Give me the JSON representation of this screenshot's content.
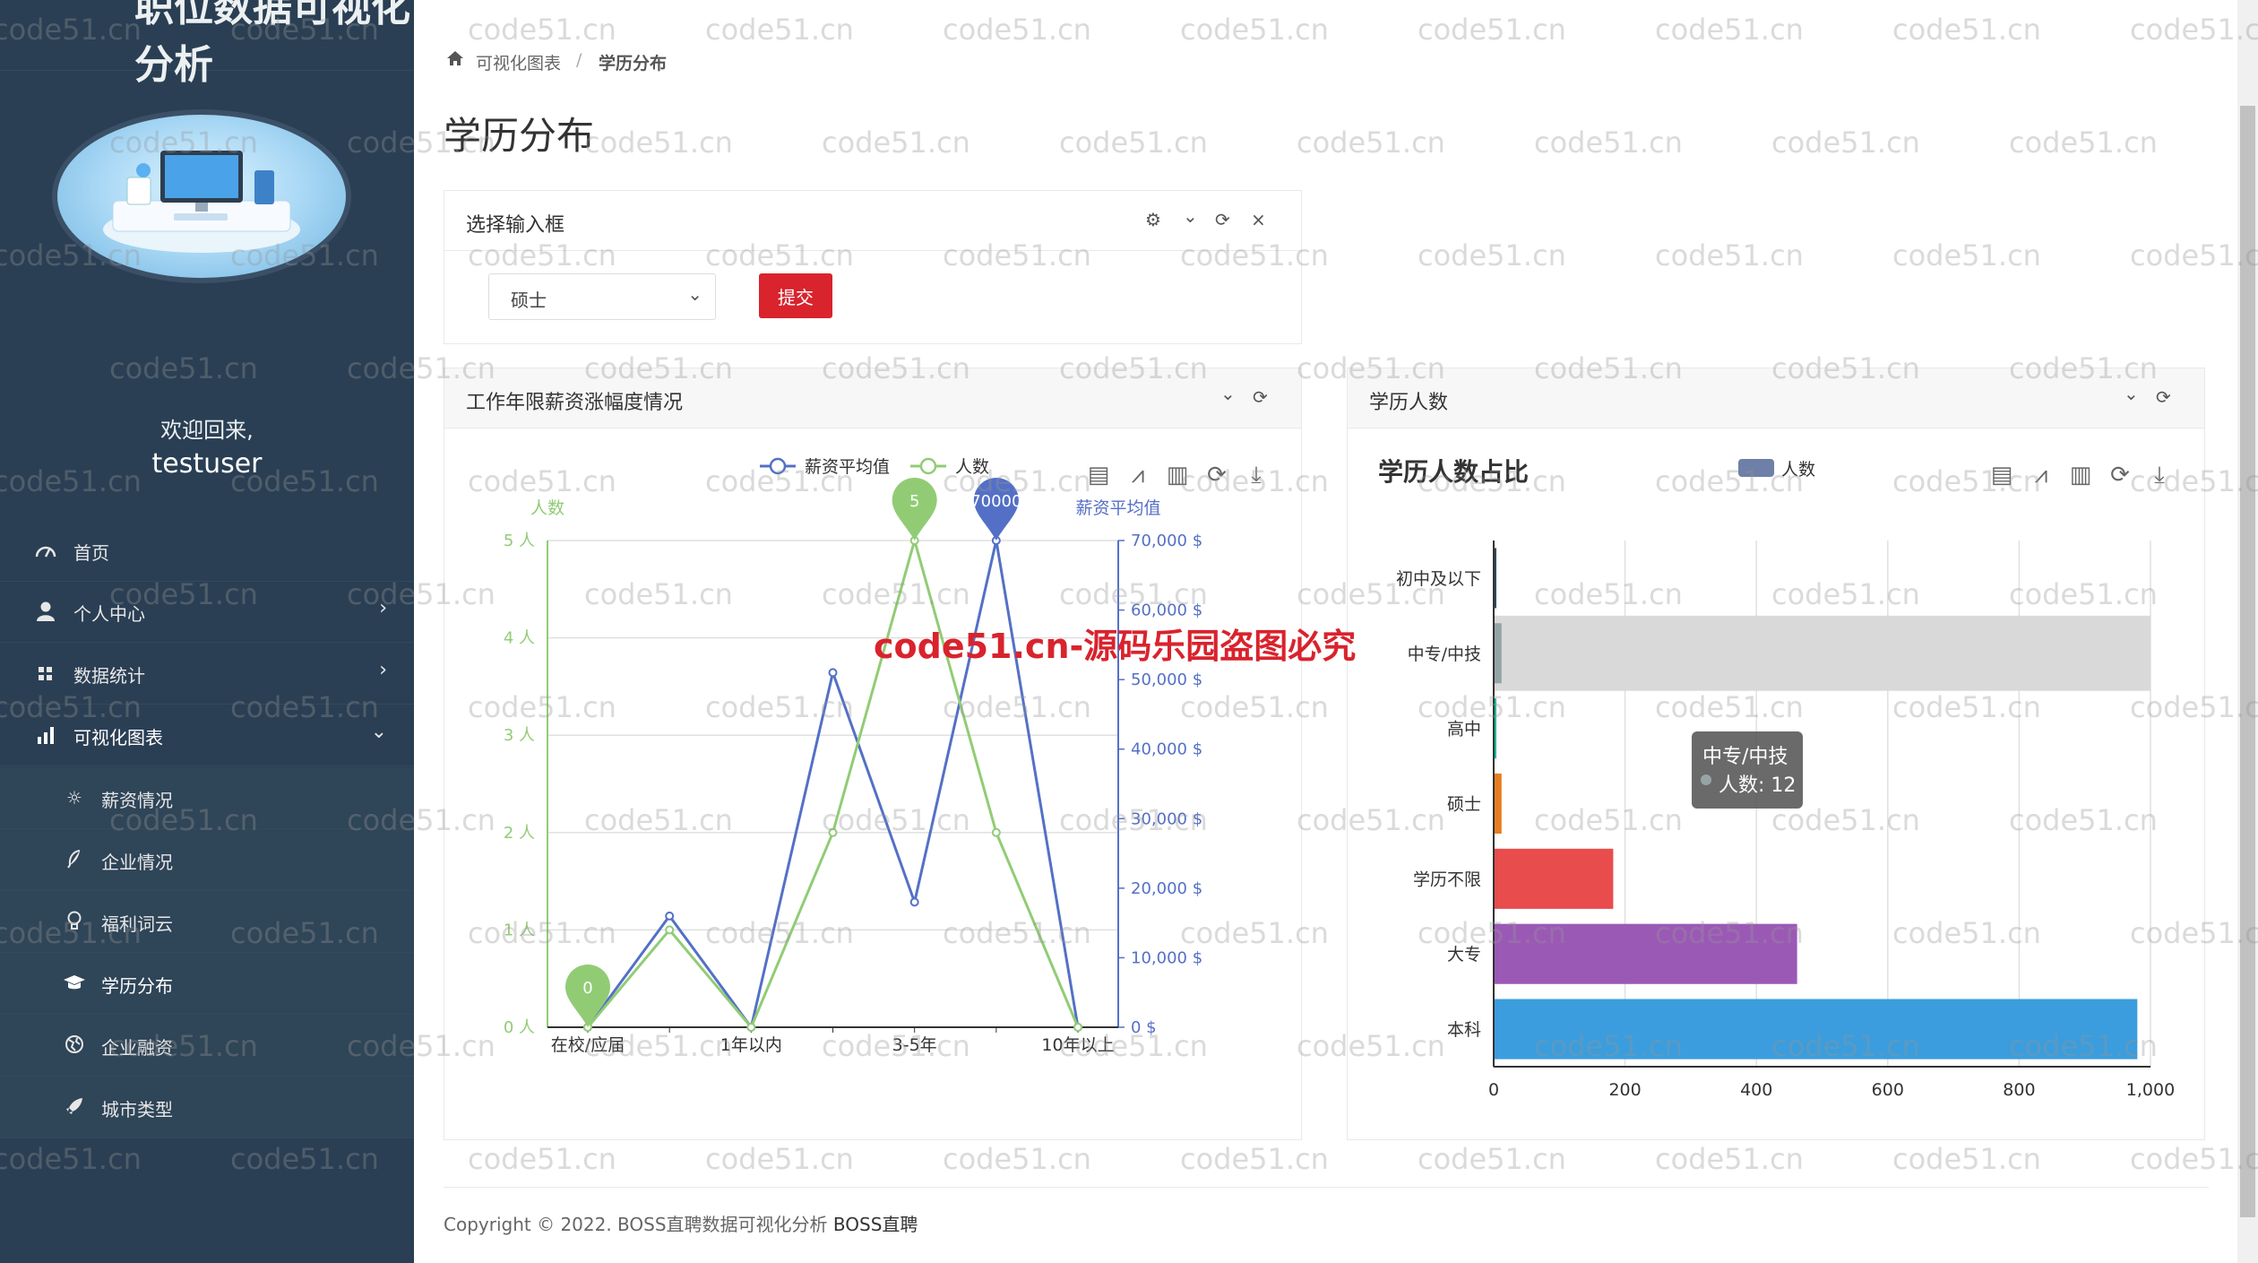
{
  "sidebar": {
    "brand_title": "职位数据可视化分析",
    "welcome": "欢迎回来,",
    "username": "testuser",
    "menu": [
      {
        "label": "首页",
        "icon": "dashboard-icon"
      },
      {
        "label": "个人中心",
        "icon": "user-icon"
      },
      {
        "label": "数据统计",
        "icon": "grid-icon"
      },
      {
        "label": "可视化图表",
        "icon": "bar-chart-icon"
      }
    ],
    "submenu": [
      {
        "label": "薪资情况",
        "icon": "sun-icon"
      },
      {
        "label": "企业情况",
        "icon": "feather-icon"
      },
      {
        "label": "福利词云",
        "icon": "lightbulb-icon"
      },
      {
        "label": "学历分布",
        "icon": "graduation-cap-icon"
      },
      {
        "label": "企业融资",
        "icon": "globe-icon"
      },
      {
        "label": "城市类型",
        "icon": "rocket-icon"
      }
    ]
  },
  "breadcrumb": {
    "parent": "可视化图表",
    "separator": "/",
    "current": "学历分布"
  },
  "page_title": "学历分布",
  "form_panel": {
    "title": "选择输入框",
    "select_value": "硕士",
    "submit_label": "提交"
  },
  "left_panel": {
    "title": "工作年限薪资涨幅度情况"
  },
  "right_panel": {
    "title": "学历人数"
  },
  "chart_data": [
    {
      "type": "line",
      "legend": [
        "薪资平均值",
        "人数"
      ],
      "x": [
        "在校/应届",
        "",
        "1年以内",
        "",
        "3-5年",
        "",
        "10年以上"
      ],
      "x_tick_labels": [
        "在校/应届",
        "1年以内",
        "3-5年",
        "10年以上"
      ],
      "series": [
        {
          "name": "薪资平均值",
          "axis": "right",
          "color": "#5470c6",
          "values": [
            0,
            16000,
            0,
            51000,
            18000,
            70000,
            0
          ]
        },
        {
          "name": "人数",
          "axis": "left",
          "color": "#91cc75",
          "values": [
            0,
            1,
            0,
            2,
            5,
            2,
            0
          ]
        }
      ],
      "y_left": {
        "label": "人数",
        "ticks": [
          "0 人",
          "1 人",
          "2 人",
          "3 人",
          "4 人",
          "5 人"
        ],
        "range": [
          0,
          5
        ]
      },
      "y_right": {
        "label": "薪资平均值",
        "ticks": [
          "0 $",
          "10,000 $",
          "20,000 $",
          "30,000 $",
          "40,000 $",
          "50,000 $",
          "60,000 $",
          "70,000 $"
        ],
        "range": [
          0,
          70000
        ]
      },
      "markers": [
        {
          "series": "人数",
          "label": "5"
        },
        {
          "series": "人数",
          "label": "0"
        },
        {
          "series": "薪资平均值",
          "label": "70000"
        }
      ]
    },
    {
      "type": "bar",
      "orientation": "horizontal",
      "title": "学历人数占比",
      "legend": [
        "人数"
      ],
      "categories": [
        "本科",
        "大专",
        "学历不限",
        "硕士",
        "高中",
        "中专/中技",
        "初中及以下"
      ],
      "values": [
        980,
        462,
        182,
        12,
        4,
        12,
        1
      ],
      "colors": [
        "#3b9ddd",
        "#9b59b6",
        "#e84c4c",
        "#e67e22",
        "#1abc9c",
        "#95a5a6",
        "#34495e"
      ],
      "x_ticks": [
        "0",
        "200",
        "400",
        "600",
        "800",
        "1,000"
      ],
      "xlim": [
        0,
        1000
      ],
      "highlighted": "中专/中技",
      "tooltip": {
        "title": "中专/中技",
        "text": "人数: 12"
      }
    }
  ],
  "footer": {
    "copyright": "Copyright © 2022. BOSS直聘数据可视化分析",
    "brand": "BOSS直聘"
  },
  "watermark": {
    "text": "code51.cn",
    "notice": "code51.cn-源码乐园盗图必究"
  }
}
